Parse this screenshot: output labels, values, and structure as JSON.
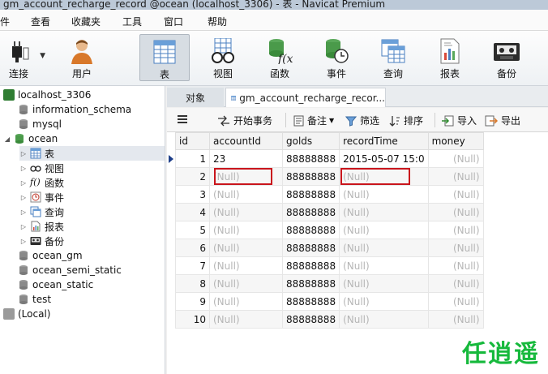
{
  "window": {
    "title": "gm_account_recharge_record @ocean (localhost_3306) - 表 - Navicat Premium"
  },
  "menu": [
    "件",
    "查看",
    "收藏夹",
    "工具",
    "窗口",
    "帮助"
  ],
  "toolbar": [
    {
      "label": "连接",
      "icon": "plug-icon"
    },
    {
      "label": "用户",
      "icon": "user-icon"
    },
    {
      "label": "表",
      "icon": "table-icon",
      "active": true
    },
    {
      "label": "视图",
      "icon": "glasses-icon"
    },
    {
      "label": "函数",
      "icon": "function-icon"
    },
    {
      "label": "事件",
      "icon": "event-clock-icon"
    },
    {
      "label": "查询",
      "icon": "query-icon"
    },
    {
      "label": "报表",
      "icon": "report-icon"
    },
    {
      "label": "备份",
      "icon": "tape-backup-icon"
    }
  ],
  "nav": {
    "items": [
      "localhost_3306",
      "information_schema",
      "mysql",
      "ocean",
      "表",
      "视图",
      "函数",
      "事件",
      "查询",
      "报表",
      "备份",
      "ocean_gm",
      "ocean_semi_static",
      "ocean_static",
      "test",
      "(Local)"
    ]
  },
  "tabs": {
    "objects": "对象",
    "current": "gm_account_recharge_recor..."
  },
  "gridbar": {
    "begin_tx": "开始事务",
    "note": "备注",
    "filter": "筛选",
    "sort": "排序",
    "import": "导入",
    "export": "导出"
  },
  "table": {
    "columns": [
      "id",
      "accountId",
      "golds",
      "recordTime",
      "money"
    ],
    "rows": [
      [
        "1",
        "23",
        "88888888",
        "2015-05-07 15:0",
        "(Null)"
      ],
      [
        "2",
        "(Null)",
        "88888888",
        "(Null)",
        "(Null)"
      ],
      [
        "3",
        "(Null)",
        "88888888",
        "(Null)",
        "(Null)"
      ],
      [
        "4",
        "(Null)",
        "88888888",
        "(Null)",
        "(Null)"
      ],
      [
        "5",
        "(Null)",
        "88888888",
        "(Null)",
        "(Null)"
      ],
      [
        "6",
        "(Null)",
        "88888888",
        "(Null)",
        "(Null)"
      ],
      [
        "7",
        "(Null)",
        "88888888",
        "(Null)",
        "(Null)"
      ],
      [
        "8",
        "(Null)",
        "88888888",
        "(Null)",
        "(Null)"
      ],
      [
        "9",
        "(Null)",
        "88888888",
        "(Null)",
        "(Null)"
      ],
      [
        "10",
        "(Null)",
        "88888888",
        "(Null)",
        "(Null)"
      ]
    ]
  },
  "watermark": "任逍遥",
  "colors": {
    "highlight": "#c9151c",
    "watermark": "#16b93c",
    "db_green": "#3a9a3a"
  }
}
